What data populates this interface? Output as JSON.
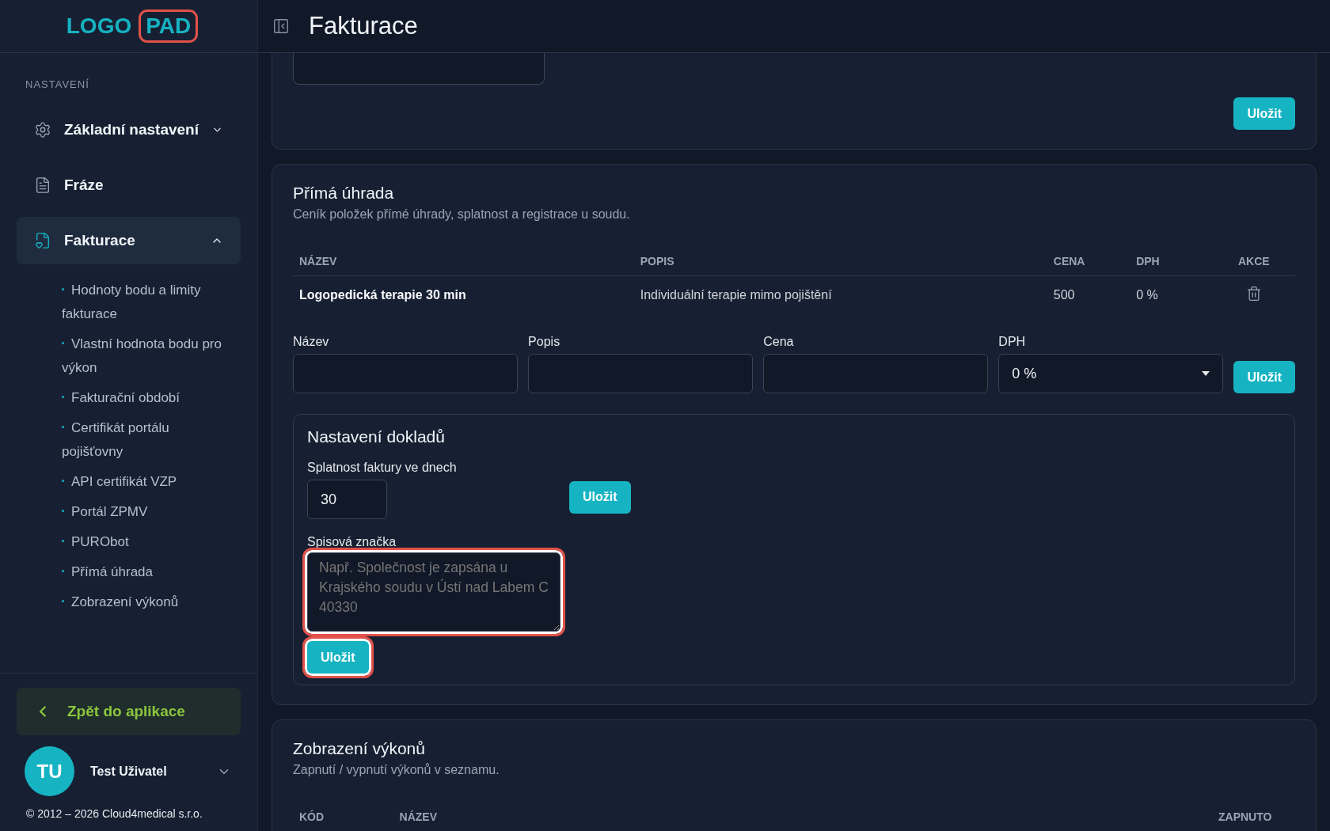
{
  "logo": {
    "part_1": "LOGO",
    "part_2": "PAD",
    "part_2_highlighted": true
  },
  "sidebar": {
    "section_label": "NASTAVENÍ",
    "items": [
      {
        "label": "Základní nastavení",
        "kind": "settings",
        "expanded": false,
        "selected": false
      },
      {
        "label": "Fráze",
        "kind": "document",
        "selected": false
      },
      {
        "label": "Fakturace",
        "kind": "invoice",
        "expanded": true,
        "selected": true,
        "children": [
          "Hodnoty bodu a limity fakturace",
          "Vlastní hodnota bodu pro výkon",
          "Fakturační období",
          "Certifikát portálu pojišťovny",
          "API certifikát VZP",
          "Portál ZPMV",
          "PURObot",
          "Přímá úhrada",
          "Zobrazení výkonů"
        ]
      }
    ],
    "back_button": "Zpět do aplikace",
    "user": {
      "initials": "TU",
      "name": "Test Uživatel"
    },
    "copyright": "© 2012 – 2026 Cloud4medical s.r.o."
  },
  "header": {
    "title": "Fakturace"
  },
  "top_card": {
    "save_button": "Uložit"
  },
  "direct_payment": {
    "title": "Přímá úhrada",
    "subtitle": "Ceník položek přímé úhrady, splatnost a registrace u soudu.",
    "columns": [
      "NÁZEV",
      "POPIS",
      "CENA",
      "DPH",
      "AKCE"
    ],
    "rows": [
      {
        "name": "Logopedická terapie 30 min",
        "description": "Individuální terapie mimo pojištění",
        "price": "500",
        "vat": "0 %"
      }
    ],
    "form": {
      "name_label": "Název",
      "description_label": "Popis",
      "price_label": "Cena",
      "vat_label": "DPH",
      "vat_value": "0 %",
      "save_button": "Uložit"
    },
    "documents": {
      "title": "Nastavení dokladů",
      "due_label": "Splatnost faktury ve dnech",
      "due_value": "30",
      "due_save": "Uložit",
      "file_label": "Spisová značka",
      "file_placeholder": "Např. Společnost je zapsána u Krajského soudu v Ústí nad Labem C 40330",
      "file_highlighted": true,
      "file_save": "Uložit",
      "file_save_highlighted": true
    }
  },
  "services": {
    "title": "Zobrazení výkonů",
    "subtitle": "Zapnutí / vypnutí výkonů v seznamu.",
    "columns": [
      "KÓD",
      "NÁZEV",
      "ZAPNUTO"
    ]
  }
}
